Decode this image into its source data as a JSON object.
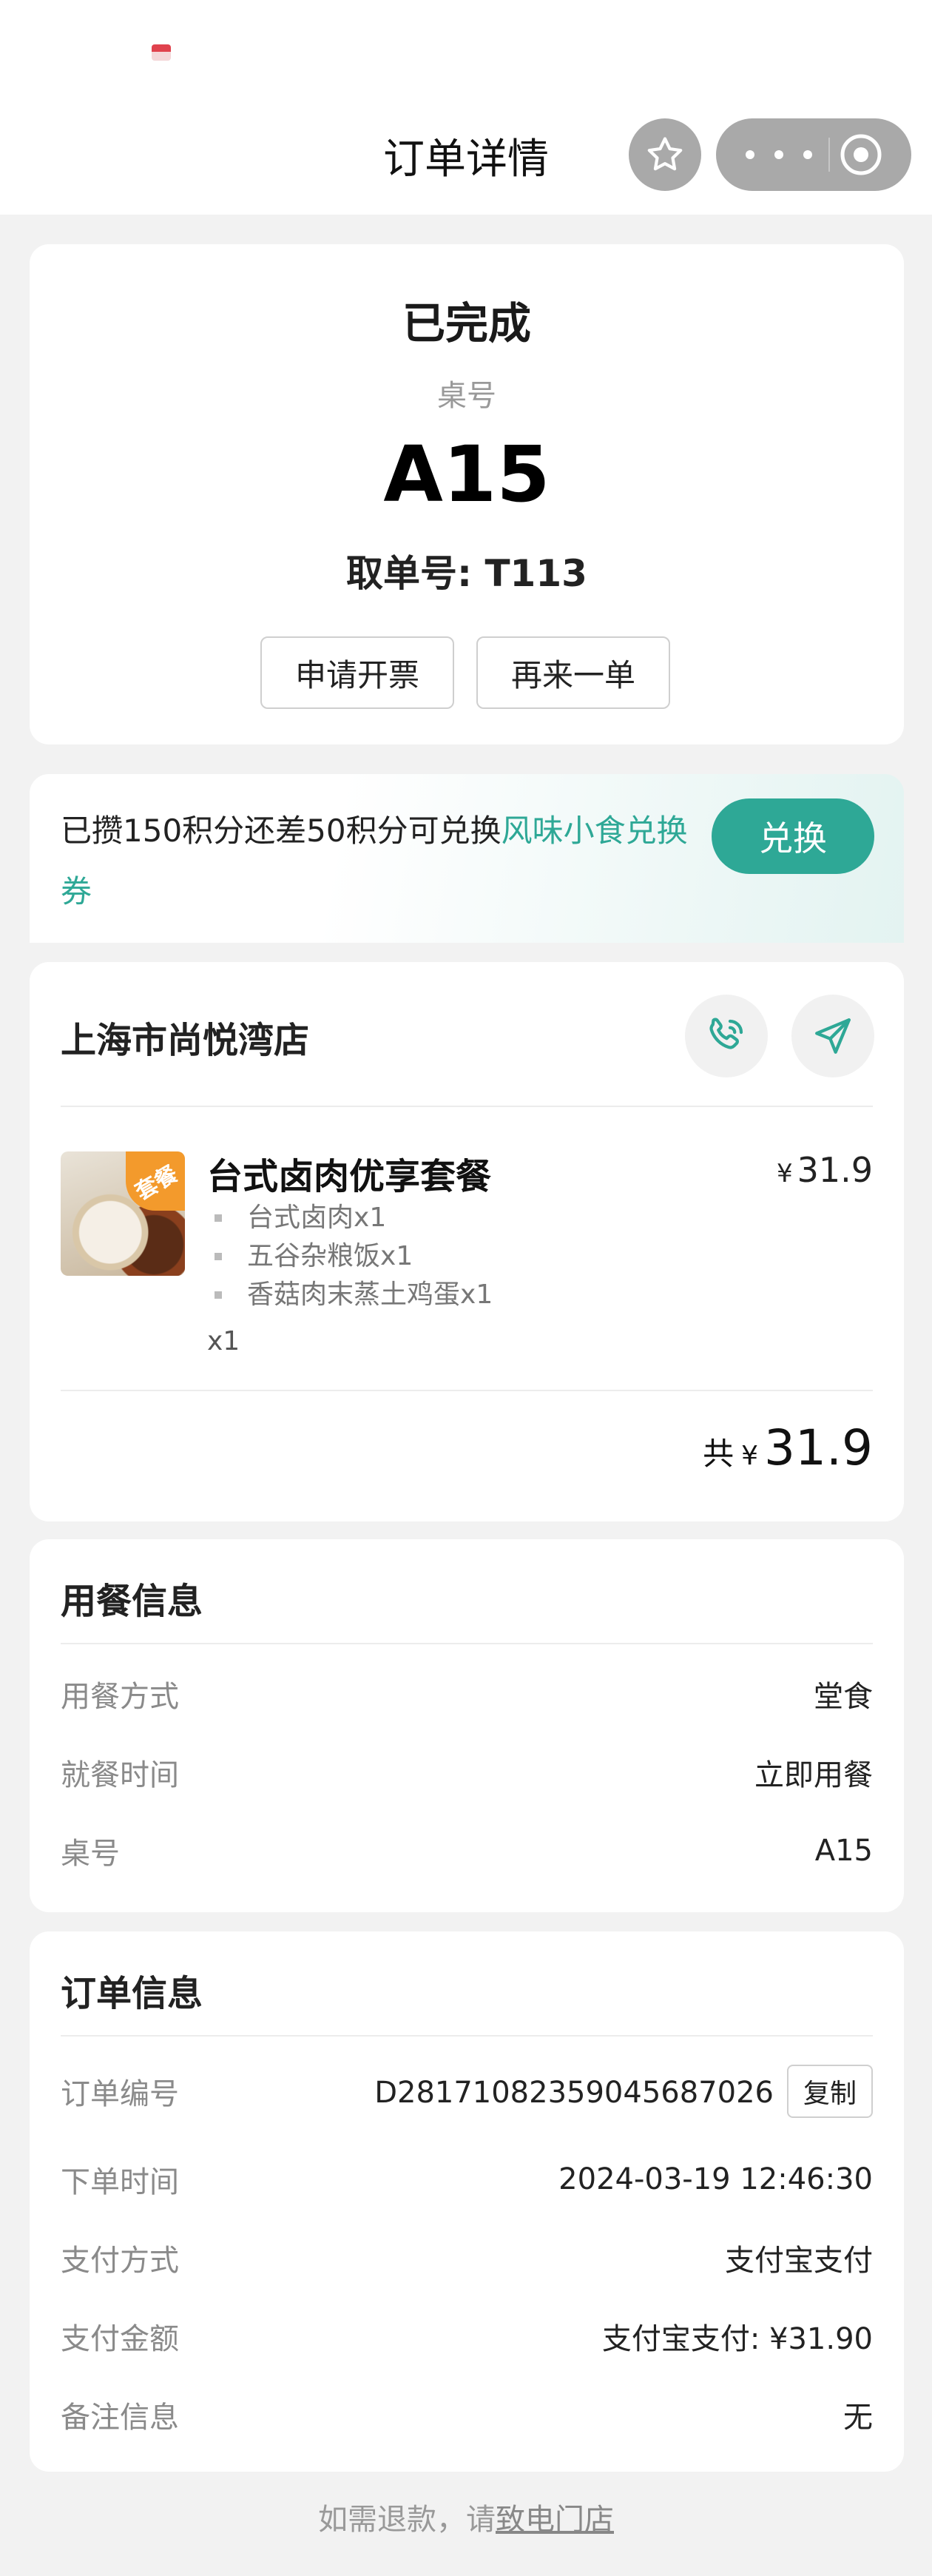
{
  "nav": {
    "title": "订单详情"
  },
  "status": {
    "text": "已完成",
    "table_label": "桌号",
    "table_number": "A15",
    "pickup": "取单号: T113",
    "buttons": {
      "invoice": "申请开票",
      "reorder": "再来一单"
    }
  },
  "points": {
    "text": "已攒150积分还差50积分可兑换",
    "highlight": "风味小食兑换券",
    "button": "兑换"
  },
  "store": {
    "name": "上海市尚悦湾店",
    "item": {
      "name": "台式卤肉优享套餐",
      "badge": "套餐",
      "currency": "¥",
      "price": "31.9",
      "sub_items": [
        {
          "name": "台式卤肉",
          "qty": "x1"
        },
        {
          "name": "五谷杂粮饭",
          "qty": "x1"
        },
        {
          "name": "香菇肉末蒸土鸡蛋",
          "qty": "x1"
        }
      ],
      "qty": "x1"
    },
    "total": {
      "label": "共",
      "currency": "¥",
      "amount": "31.9"
    }
  },
  "dining": {
    "title": "用餐信息",
    "rows": [
      {
        "label": "用餐方式",
        "value": "堂食"
      },
      {
        "label": "就餐时间",
        "value": "立即用餐"
      },
      {
        "label": "桌号",
        "value": "A15"
      }
    ]
  },
  "order": {
    "title": "订单信息",
    "rows": [
      {
        "label": "订单编号",
        "value": "D28171082359045687026"
      },
      {
        "label": "下单时间",
        "value": "2024-03-19 12:46:30"
      },
      {
        "label": "支付方式",
        "value": "支付宝支付"
      },
      {
        "label": "支付金额",
        "value": "支付宝支付: ¥31.90"
      },
      {
        "label": "备注信息",
        "value": "无"
      }
    ],
    "copy_label": "复制"
  },
  "footer": {
    "refund_text": "如需退款，请",
    "refund_link": "致电门店"
  },
  "colors": {
    "accent": "#2ea896",
    "capsule": "#a9a9a9"
  }
}
